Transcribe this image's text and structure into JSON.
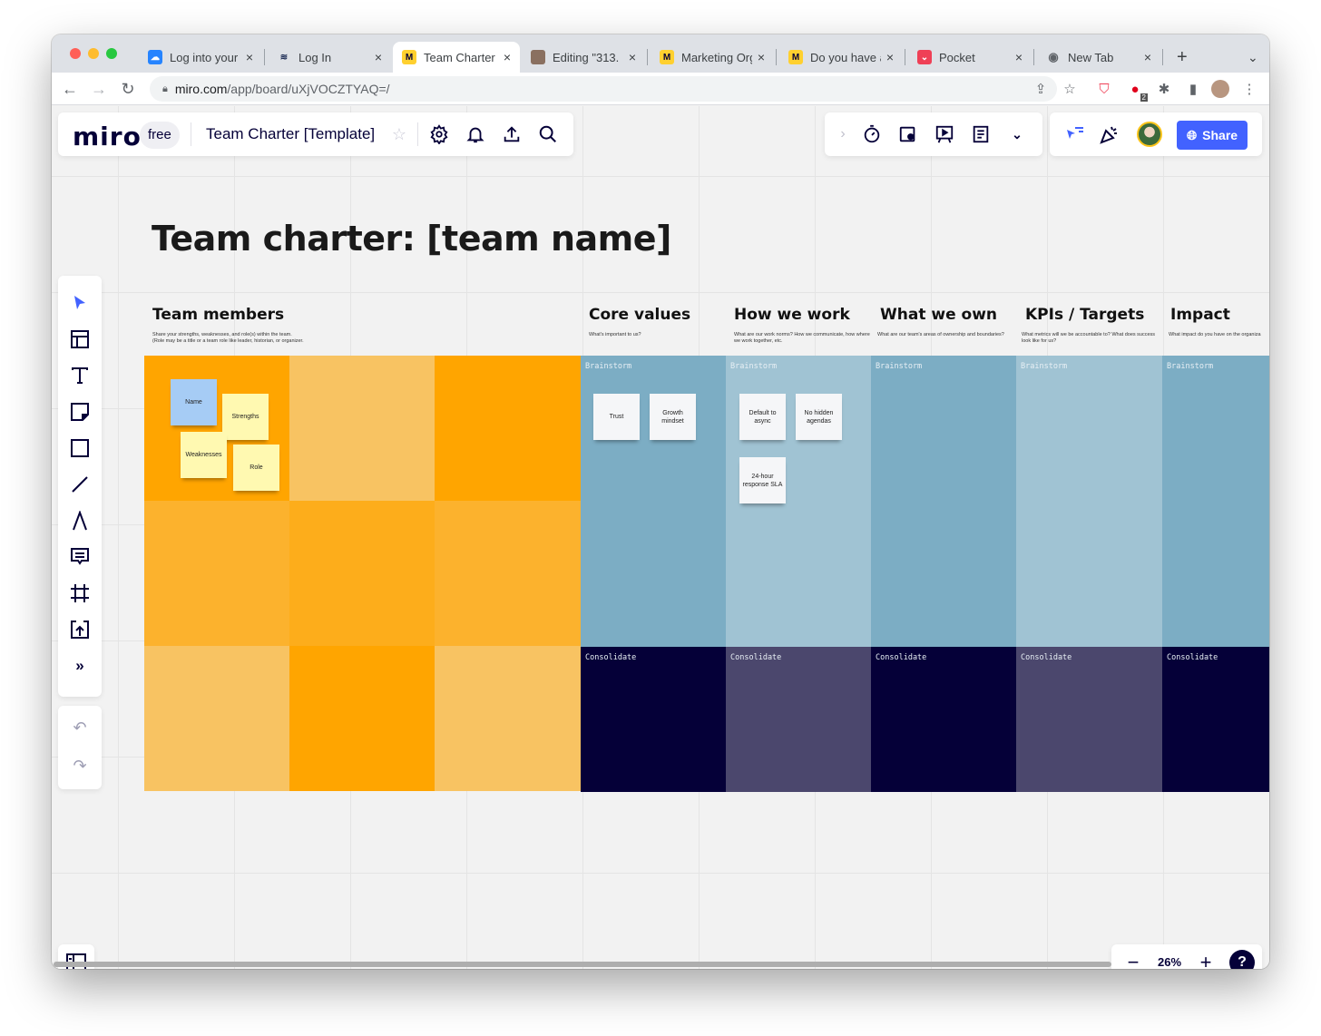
{
  "browser": {
    "tabs": [
      {
        "title": "Log into your",
        "icon": "atlassian-icon",
        "color": "#2684ff"
      },
      {
        "title": "Log In",
        "icon": "buffer-icon",
        "color": "#ffffff"
      },
      {
        "title": "Team Charter",
        "icon": "miro-icon",
        "color": "#ffd02f",
        "active": true
      },
      {
        "title": "Editing \"313.",
        "icon": "profile-photo-icon",
        "color": "#8a7060"
      },
      {
        "title": "Marketing Org",
        "icon": "miro-icon",
        "color": "#ffd02f"
      },
      {
        "title": "Do you have a",
        "icon": "miro-icon",
        "color": "#ffd02f"
      },
      {
        "title": "Pocket",
        "icon": "pocket-icon",
        "color": "#ef4056"
      },
      {
        "title": "New Tab",
        "icon": "chrome-icon",
        "color": "#ffffff"
      }
    ],
    "close_glyph": "×",
    "new_tab_glyph": "+",
    "tab_menu_glyph": "⌄",
    "url_domain": "miro.com",
    "url_path": "/app/board/uXjVOCZTYAQ=/",
    "extension_badge": "2"
  },
  "miro": {
    "logo": "miro",
    "plan_badge": "free",
    "board_title": "Team Charter [Template]",
    "share_label": "Share",
    "zoom_level": "26%",
    "help_glyph": "?",
    "more_tools_glyph": "»"
  },
  "canvas": {
    "title": "Team charter: [team name]",
    "team_members": {
      "heading": "Team members",
      "description": "Share your strengths, weaknesses, and role(s) within the team.\n(Role may be a title or a team role like leader, historian, or organizer.",
      "stickies": [
        "Name",
        "Strengths",
        "Weaknesses",
        "Role"
      ]
    },
    "columns": [
      {
        "heading": "Core values",
        "description": "What's important to us?",
        "brainstorm": "Brainstorm",
        "consolidate": "Consolidate",
        "stickies": [
          "Trust",
          "Growth mindset"
        ]
      },
      {
        "heading": "How we work",
        "description": "What are our work norms? How we communicate, how where we work together, etc.",
        "brainstorm": "Brainstorm",
        "consolidate": "Consolidate",
        "stickies": [
          "Default to async",
          "No hidden agendas",
          "24-hour response SLA"
        ]
      },
      {
        "heading": "What we own",
        "description": "What are our team's areas of ownership and boundaries?",
        "brainstorm": "Brainstorm",
        "consolidate": "Consolidate",
        "stickies": []
      },
      {
        "heading": "KPIs / Targets",
        "description": "What metrics will we be accountable to? What does success look like for us?",
        "brainstorm": "Brainstorm",
        "consolidate": "Consolidate",
        "stickies": []
      },
      {
        "heading": "Impact",
        "description": "What impact do you have on the organiza",
        "brainstorm": "Brainstorm",
        "consolidate": "Consolidate",
        "stickies": []
      }
    ]
  },
  "colors": {
    "miro_blue": "#4262ff",
    "orange_dark": "#ffa500",
    "orange_mid": "#fcb22d",
    "orange_light": "#f8c362",
    "blue_dark": "#7cadc4",
    "blue_light": "#a0c3d3",
    "navy_dark": "#050038",
    "navy_light": "#4b476d",
    "sticky_yellow": "#fff9b1",
    "sticky_blue": "#a6ccf5",
    "sticky_white": "#f5f6f8"
  }
}
